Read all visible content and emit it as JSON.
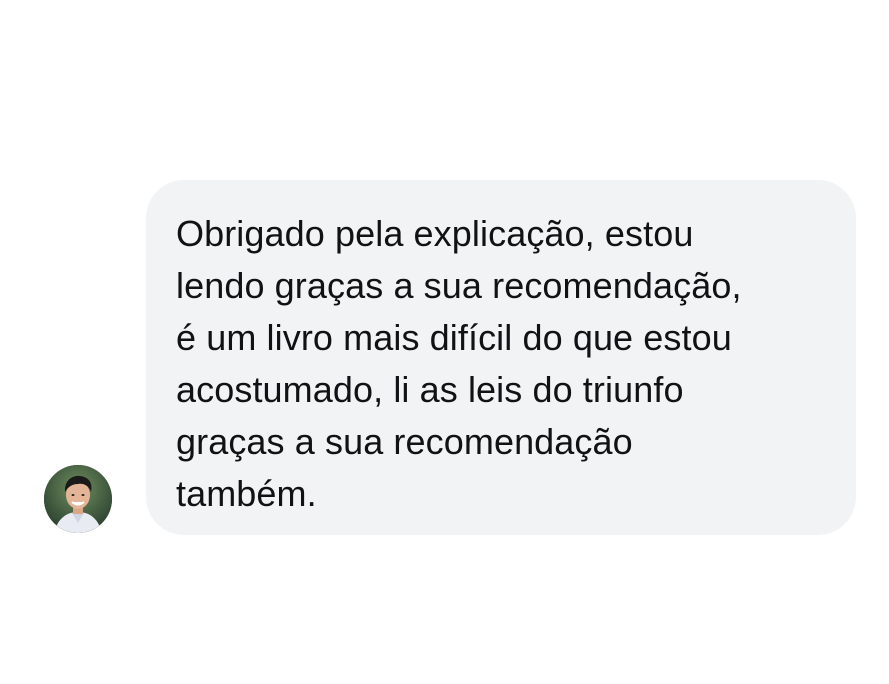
{
  "message": {
    "lines": [
      "Obrigado pela explicação, estou",
      "lendo graças a sua recomendação,",
      "é um livro mais difícil do que estou",
      "acostumado, li as leis do triunfo",
      "graças a sua recomendação",
      "também."
    ]
  },
  "colors": {
    "bubble_background": "#f1f3f5",
    "text": "#111214",
    "page_background": "#ffffff"
  },
  "icons": {
    "avatar": "user-avatar-photo"
  }
}
